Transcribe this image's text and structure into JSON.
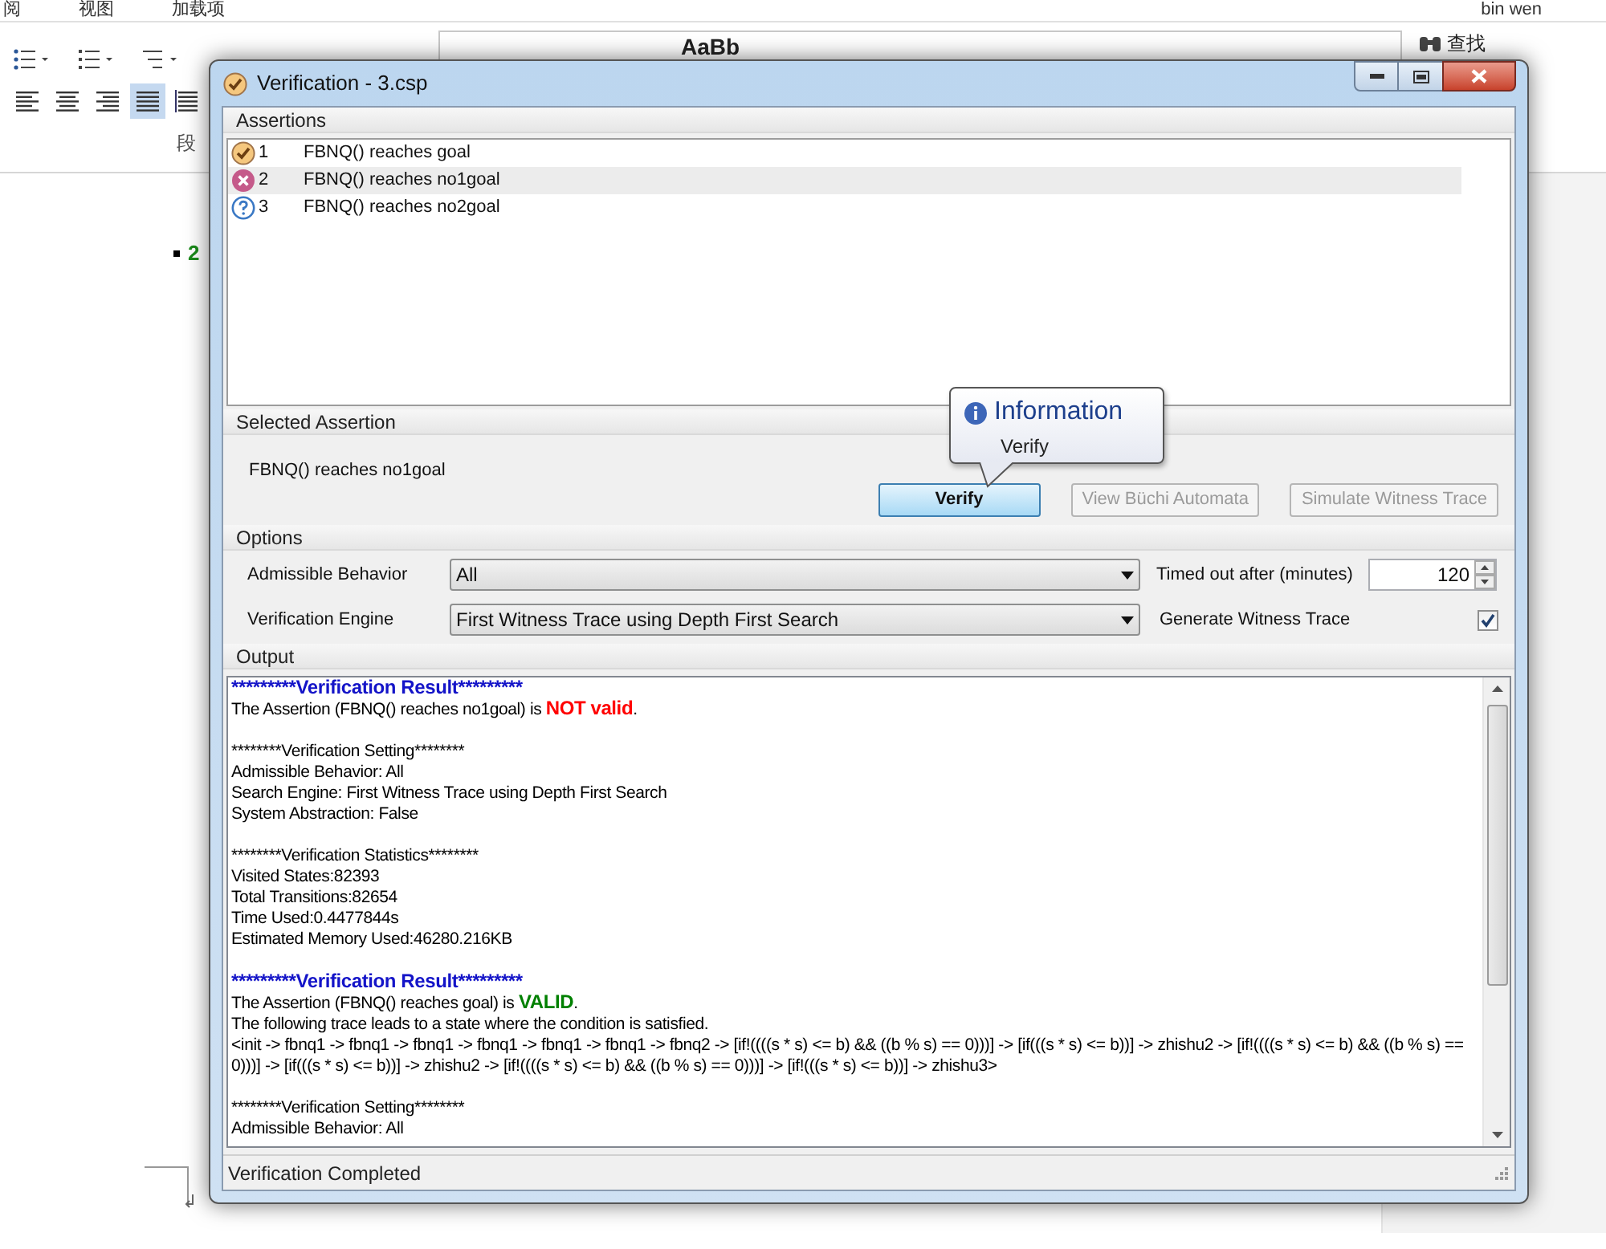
{
  "word": {
    "menu_tabs": [
      "阅",
      "视图",
      "加载项"
    ],
    "user": "bin wen",
    "find_label": "查找",
    "style_preview": "AaBb",
    "group_label": "段",
    "align_buttons": [
      {
        "kind": "left",
        "selected": false
      },
      {
        "kind": "center",
        "selected": false
      },
      {
        "kind": "right",
        "selected": false
      },
      {
        "kind": "justify",
        "selected": true
      },
      {
        "kind": "distributed",
        "selected": false
      }
    ],
    "list_number": "2"
  },
  "dialog": {
    "title": "Verification - 3.csp",
    "assertions": {
      "header": "Assertions",
      "rows": [
        {
          "number": "1",
          "text": "FBNQ() reaches goal",
          "kind": "valid",
          "selected": false
        },
        {
          "number": "2",
          "text": "FBNQ() reaches no1goal",
          "kind": "invalid",
          "selected": true
        },
        {
          "number": "3",
          "text": "FBNQ() reaches no2goal",
          "kind": "unknown",
          "selected": false
        }
      ]
    },
    "selected_assertion": {
      "header": "Selected Assertion",
      "text": "FBNQ() reaches no1goal",
      "buttons": [
        {
          "label": "Verify",
          "disabled": false
        },
        {
          "label": "View Büchi Automata",
          "disabled": true
        },
        {
          "label": "Simulate Witness Trace",
          "disabled": true
        }
      ],
      "tooltip": {
        "title": "Information",
        "text": "Verify"
      }
    },
    "options": {
      "header": "Options",
      "admissible_label": "Admissible Behavior",
      "admissible_value": "All",
      "engine_label": "Verification Engine",
      "engine_value": "First Witness Trace using Depth First Search",
      "timeout_label": "Timed out after (minutes)",
      "timeout_value": "120",
      "witness_label": "Generate Witness Trace",
      "witness_checked": true
    },
    "output": {
      "header": "Output",
      "lines": [
        {
          "kind": "heading",
          "text": "*********Verification Result*********"
        },
        {
          "kind": "result",
          "text": "The Assertion (FBNQ() reaches no1goal) is ",
          "verdict": "NOT valid",
          "color": "#ff0000",
          "suffix": "."
        },
        {
          "kind": "gap"
        },
        {
          "kind": "text",
          "text": "********Verification Setting********"
        },
        {
          "kind": "text",
          "text": "Admissible Behavior: All"
        },
        {
          "kind": "text",
          "text": "Search Engine: First Witness Trace using Depth First Search"
        },
        {
          "kind": "text",
          "text": "System Abstraction: False"
        },
        {
          "kind": "gap"
        },
        {
          "kind": "text",
          "text": "********Verification Statistics********"
        },
        {
          "kind": "text",
          "text": "Visited States:82393"
        },
        {
          "kind": "text",
          "text": "Total Transitions:82654"
        },
        {
          "kind": "text",
          "text": "Time Used:0.4477844s"
        },
        {
          "kind": "text",
          "text": "Estimated Memory Used:46280.216KB"
        },
        {
          "kind": "gap"
        },
        {
          "kind": "heading",
          "text": "*********Verification Result*********"
        },
        {
          "kind": "result",
          "text": "The Assertion (FBNQ() reaches goal) is ",
          "verdict": "VALID",
          "color": "#008000",
          "suffix": "."
        },
        {
          "kind": "text",
          "text": "The following trace leads to a state where the condition is satisfied."
        },
        {
          "kind": "text",
          "text": "<init -> fbnq1 -> fbnq1 -> fbnq1 -> fbnq1 -> fbnq1 -> fbnq1 -> fbnq2 -> [if!((((s * s) <= b) && ((b % s) == 0)))] -> [if(((s * s) <= b))] -> zhishu2 -> [if!((((s * s) <= b) && ((b % s) == 0)))] -> [if(((s * s) <= b))] -> zhishu2 -> [if!((((s * s) <= b) && ((b % s) == 0)))] -> [if!(((s * s) <= b))] -> zhishu3>"
        },
        {
          "kind": "gap"
        },
        {
          "kind": "text",
          "text": "********Verification Setting********"
        },
        {
          "kind": "text",
          "text": "Admissible Behavior: All"
        }
      ]
    },
    "status": "Verification Completed"
  }
}
